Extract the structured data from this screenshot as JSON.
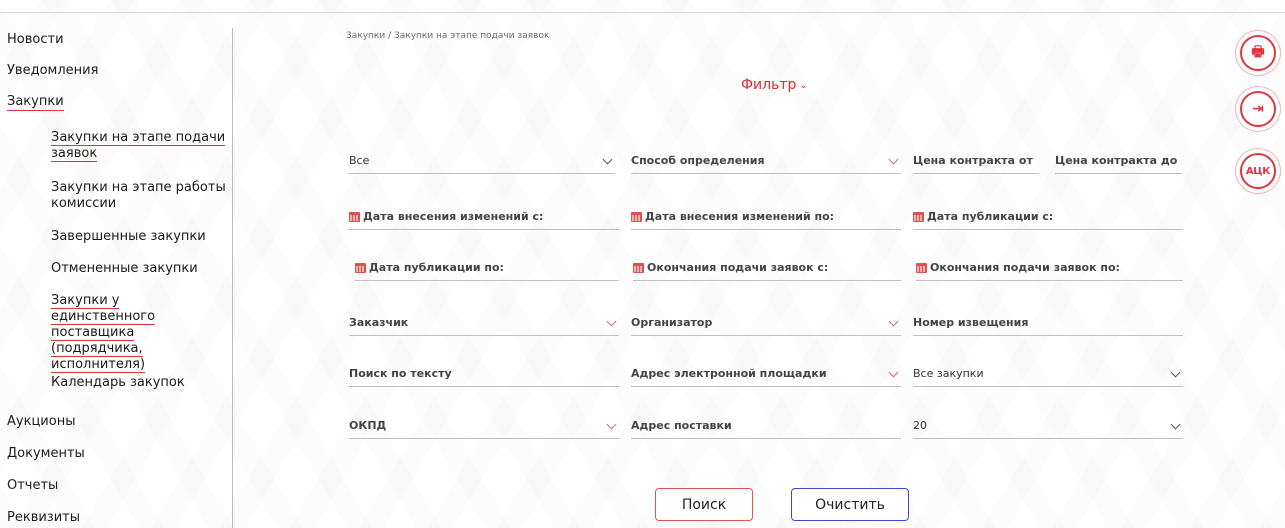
{
  "sidebar": {
    "items": [
      {
        "label": "Новости"
      },
      {
        "label": "Уведомления"
      },
      {
        "label": "Закупки"
      }
    ],
    "subitems": [
      {
        "label": "Закупки на этапе подачи заявок"
      },
      {
        "label": "Закупки на этапе работы комиссии"
      },
      {
        "label": "Завершенные закупки"
      },
      {
        "label": "Отмененные закупки"
      },
      {
        "label": "Закупки у единственного поставщика (подрядчика, исполнителя)"
      },
      {
        "label": "Календарь закупок"
      }
    ],
    "bottom_items": [
      {
        "label": "Аукционы"
      },
      {
        "label": "Документы"
      },
      {
        "label": "Отчеты"
      },
      {
        "label": "Реквизиты"
      }
    ]
  },
  "breadcrumb": "Закупки / Закупки на этапе подачи заявок",
  "filter": {
    "title": "Фильтр",
    "chevron": "⌄",
    "fields": {
      "all": "Все",
      "method": "Способ определения",
      "price_from": "Цена контракта от",
      "price_to": "Цена контракта до",
      "change_date_from": "Дата внесения изменений с:",
      "change_date_to": "Дата внесения изменений по:",
      "pub_date_from": "Дата публикации с:",
      "pub_date_to": "Дата публикации по:",
      "deadline_from": "Окончания подачи заявок с:",
      "deadline_to": "Окончания подачи заявок по:",
      "customer": "Заказчик",
      "organizer": "Организатор",
      "notice_number": "Номер извещения",
      "text_search": "Поиск по тексту",
      "platform_address": "Адрес электронной площадки",
      "all_purchases": "Все закупки",
      "okpd": "ОКПД",
      "delivery_address": "Адрес поставки",
      "page_size": "20"
    }
  },
  "buttons": {
    "search": "Поиск",
    "clear": "Очистить"
  },
  "right_icons": {
    "first_glyph": "🖶",
    "second_glyph": "⇥",
    "atsk": "АЦК"
  },
  "colors": {
    "accent_red": "#e0363f",
    "clear_button_border": "#3b49d9"
  }
}
